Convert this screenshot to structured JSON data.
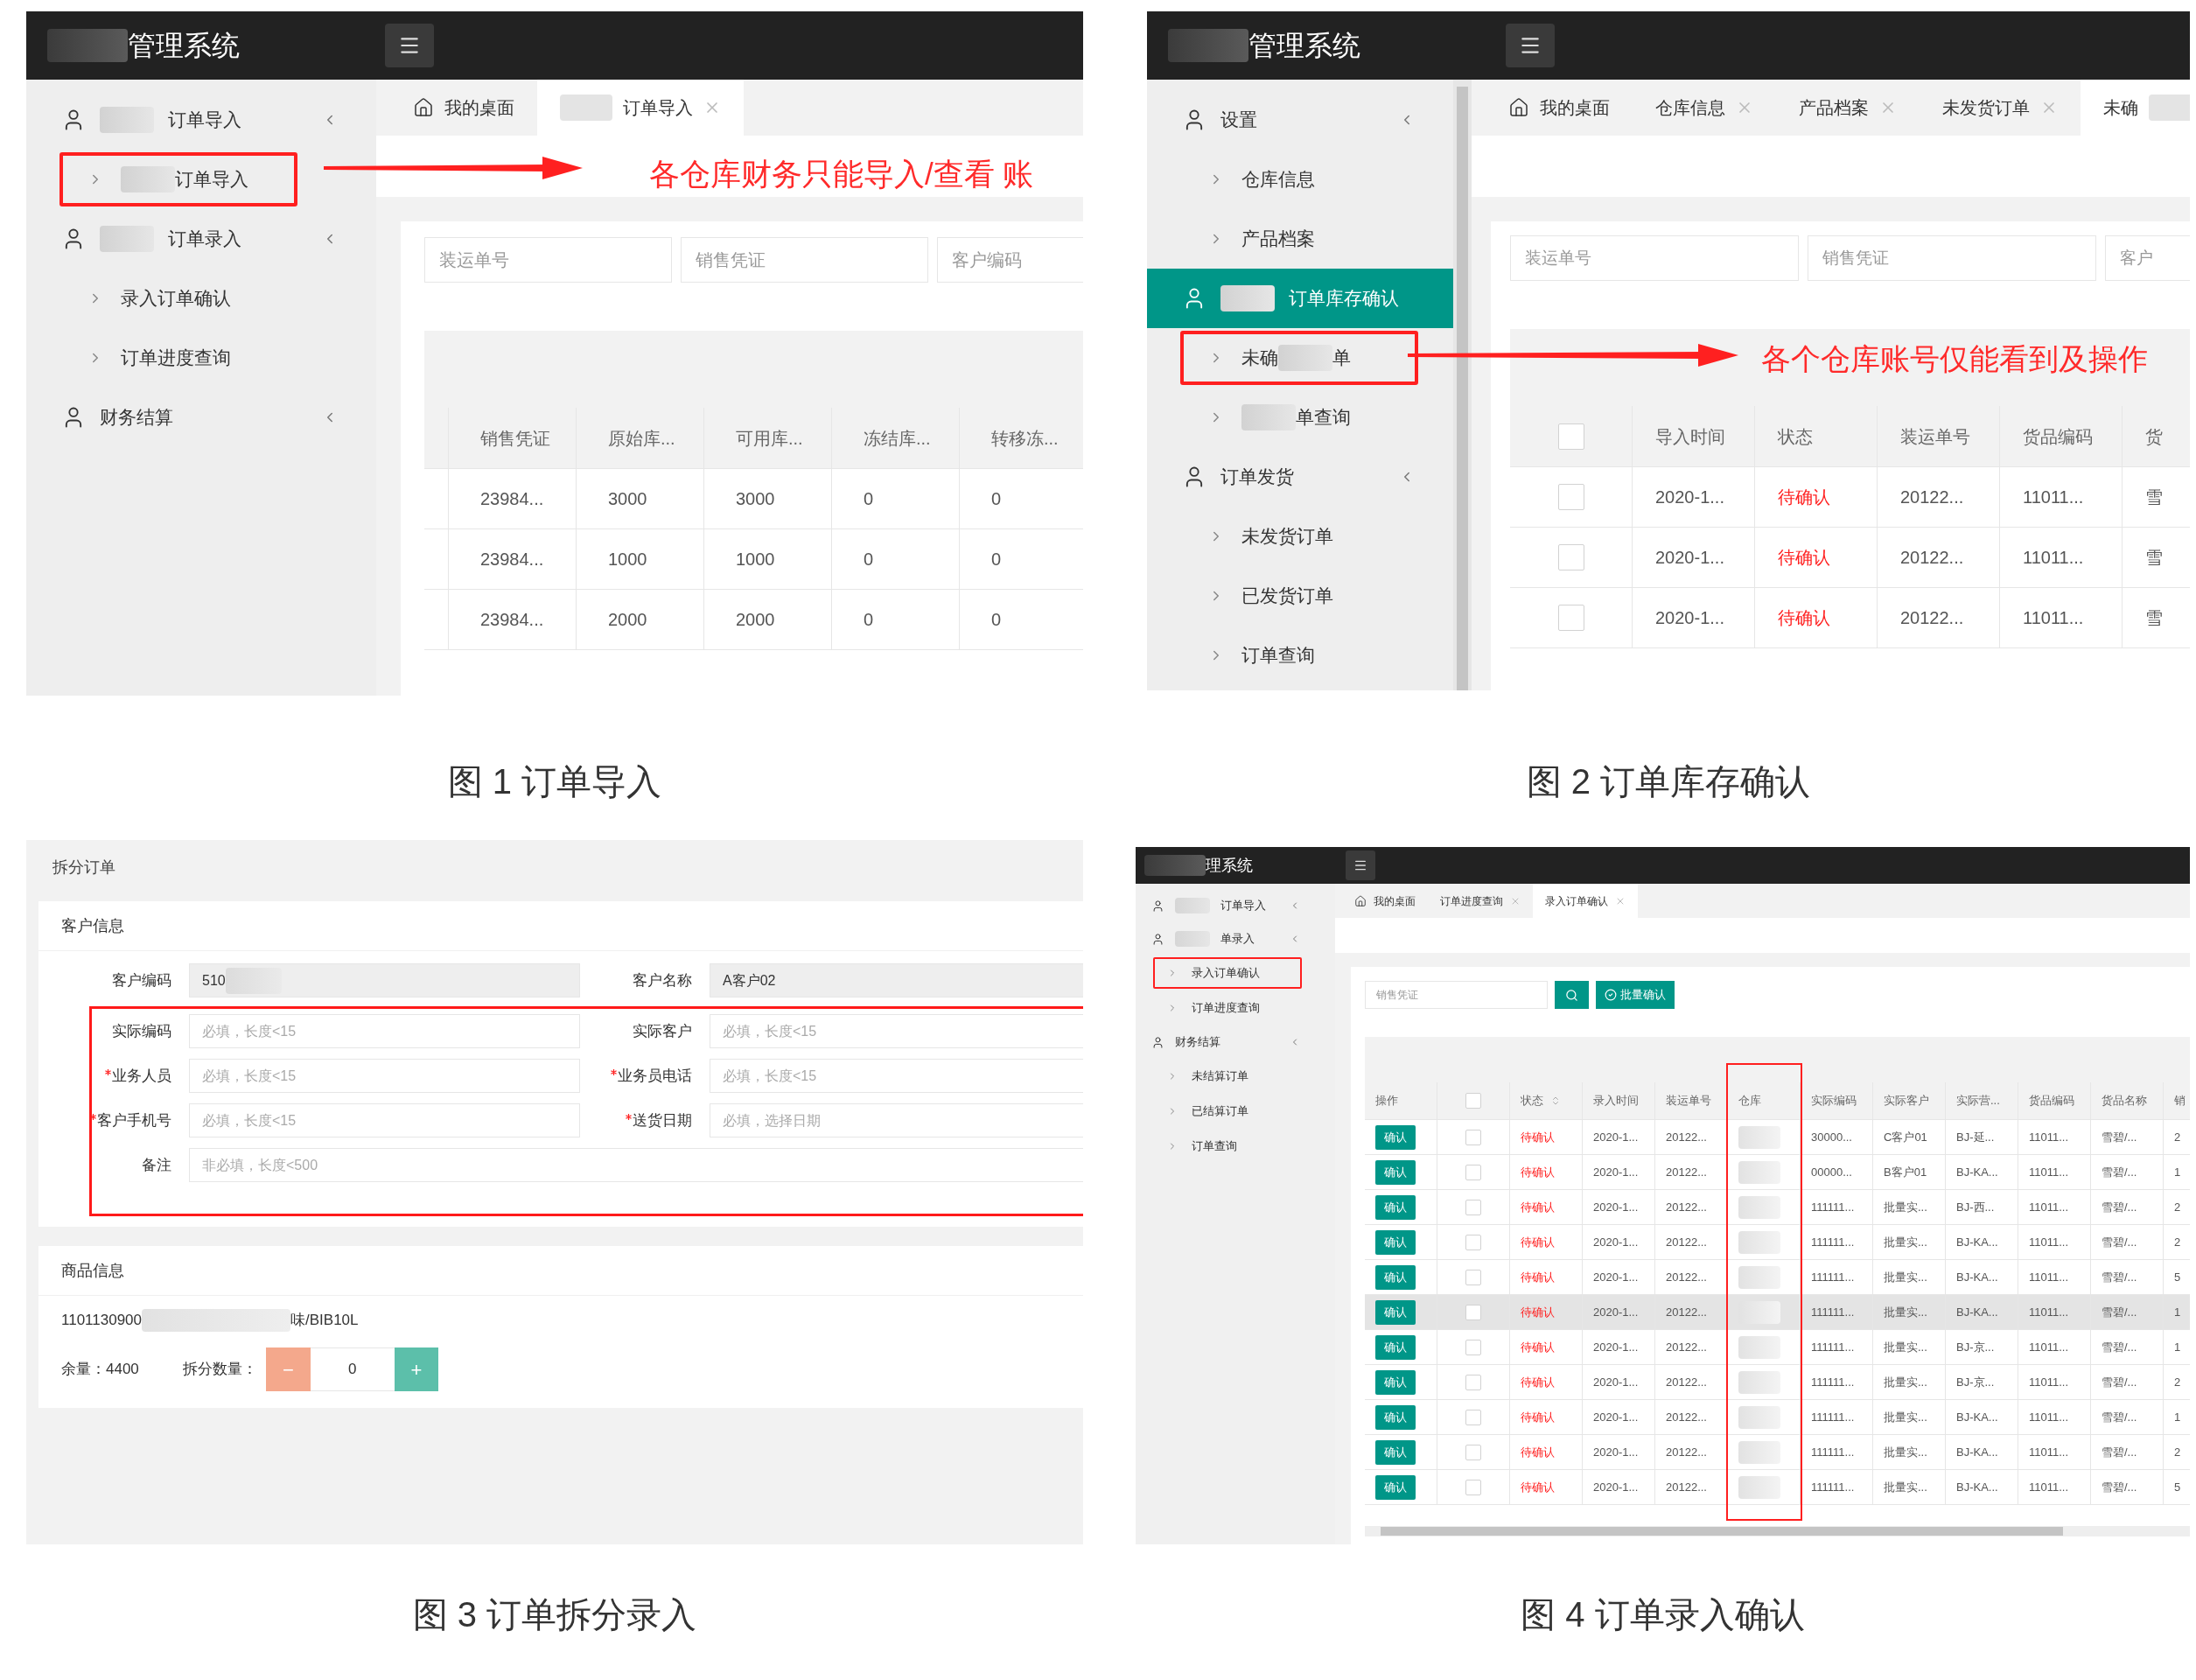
{
  "figure_1": {
    "logo": {
      "label": "管理系统",
      "mask_before": true
    },
    "sidebar": [
      {
        "label": "订单导入",
        "mask_before": true,
        "selected": false,
        "children": [
          {
            "label": "订单导入",
            "mask_before": true,
            "highlighted": true
          }
        ]
      },
      {
        "label": "订单录入",
        "mask_before": true,
        "selected": false,
        "children": [
          {
            "label": "录入订单确认",
            "highlighted": false
          },
          {
            "label": "订单进度查询",
            "highlighted": false
          }
        ]
      },
      {
        "label": "财务结算",
        "selected": false
      }
    ],
    "tabs": [
      {
        "kind": "home",
        "label": "我的桌面",
        "selected": false,
        "closable": false
      },
      {
        "kind": "page",
        "label": "订单导入",
        "mask_before": true,
        "selected": true,
        "closable": true
      }
    ],
    "annotation": "各仓库财务只能导入/查看 账",
    "filters": [
      {
        "placeholder": "装运单号"
      },
      {
        "placeholder": "销售凭证"
      },
      {
        "placeholder": "客户编码"
      }
    ],
    "table": {
      "columns": [
        {
          "kind": "text",
          "label": "销售凭证"
        },
        {
          "kind": "text",
          "label": "原始库..."
        },
        {
          "kind": "text",
          "label": "可用库..."
        },
        {
          "kind": "text",
          "label": "冻结库..."
        },
        {
          "kind": "text",
          "label": "转移冻..."
        }
      ],
      "rows": [
        {
          "cells": [
            "23984...",
            "3000",
            "3000",
            "0",
            "0"
          ]
        },
        {
          "cells": [
            "23984...",
            "1000",
            "1000",
            "0",
            "0"
          ]
        },
        {
          "cells": [
            "23984...",
            "2000",
            "2000",
            "0",
            "0"
          ]
        }
      ]
    },
    "caption": "图 1 订单导入"
  },
  "figure_2": {
    "logo": {
      "label": "管理系统",
      "mask_before": true
    },
    "sidebar": [
      {
        "label": "设置",
        "selected": false,
        "children": [
          {
            "label": "仓库信息",
            "highlighted": false
          },
          {
            "label": "产品档案",
            "highlighted": false
          }
        ]
      },
      {
        "label": "订单库存确认",
        "mask_before": true,
        "selected": true,
        "children": [
          {
            "label": "未确",
            "mask_after": true,
            "label_end": "单",
            "highlighted": true
          },
          {
            "label": "单查询",
            "mask_before": true,
            "highlighted": false
          }
        ]
      },
      {
        "label": "订单发货",
        "selected": false,
        "children": [
          {
            "label": "未发货订单",
            "highlighted": false
          },
          {
            "label": "已发货订单",
            "highlighted": false
          },
          {
            "label": "订单查询",
            "highlighted": false
          }
        ]
      }
    ],
    "tabs": [
      {
        "kind": "home",
        "label": "我的桌面",
        "selected": false,
        "closable": false
      },
      {
        "kind": "page",
        "label": "仓库信息",
        "selected": false,
        "closable": true
      },
      {
        "kind": "page",
        "label": "产品档案",
        "selected": false,
        "closable": true
      },
      {
        "kind": "page",
        "label": "未发货订单",
        "selected": false,
        "closable": true
      },
      {
        "kind": "page",
        "label": "未确",
        "mask_after": true,
        "selected": true,
        "closable": false
      }
    ],
    "annotation": "各个仓库账号仅能看到及操作",
    "filters": [
      {
        "placeholder": "装运单号"
      },
      {
        "placeholder": "销售凭证"
      },
      {
        "placeholder": "客户"
      }
    ],
    "table": {
      "header_checked": false,
      "columns": [
        {
          "kind": "checkbox"
        },
        {
          "kind": "text",
          "label": "导入时间"
        },
        {
          "kind": "text",
          "label": "状态"
        },
        {
          "kind": "text",
          "label": "装运单号"
        },
        {
          "kind": "text",
          "label": "货品编码"
        },
        {
          "kind": "text",
          "label": "货"
        }
      ],
      "rows": [
        {
          "cells": [
            {
              "kind": "checkbox",
              "checked": false
            },
            "2020-1...",
            {
              "kind": "status",
              "text": "待确认"
            },
            "20122...",
            "11011...",
            "雪"
          ]
        },
        {
          "cells": [
            {
              "kind": "checkbox",
              "checked": false
            },
            "2020-1...",
            {
              "kind": "status",
              "text": "待确认"
            },
            "20122...",
            "11011...",
            "雪"
          ]
        },
        {
          "cells": [
            {
              "kind": "checkbox",
              "checked": false
            },
            "2020-1...",
            {
              "kind": "status",
              "text": "待确认"
            },
            "20122...",
            "11011...",
            "雪"
          ]
        }
      ]
    },
    "caption": "图 2 订单库存确认"
  },
  "figure_3": {
    "title": "拆分订单",
    "customer_info": {
      "title": "客户信息",
      "rows": [
        [
          {
            "label": "客户编码",
            "required": false,
            "readonly": true,
            "value": "510",
            "mask_after": true
          },
          {
            "label": "客户名称",
            "required": false,
            "readonly": true,
            "value": "A客户02"
          }
        ]
      ],
      "highlighted_fields": {
        "highlighted": true,
        "rows": [
          [
            {
              "label": "实际编码",
              "required": false,
              "readonly": false,
              "placeholder": "必填，长度<15"
            },
            {
              "label": "实际客户",
              "required": false,
              "readonly": false,
              "placeholder": "必填，长度<15"
            }
          ],
          [
            {
              "label": "业务人员",
              "required": true,
              "readonly": false,
              "placeholder": "必填，长度<15"
            },
            {
              "label": "业务员电话",
              "required": true,
              "readonly": false,
              "placeholder": "必填，长度<15"
            }
          ],
          [
            {
              "label": "客户手机号",
              "required": true,
              "readonly": false,
              "placeholder": "必填，长度<15"
            },
            {
              "label": "送货日期",
              "required": true,
              "readonly": false,
              "placeholder": "必填，选择日期"
            }
          ],
          [
            {
              "label": "备注",
              "required": false,
              "readonly": false,
              "placeholder": "非必填，长度<500"
            }
          ]
        ]
      }
    },
    "product_info": {
      "title": "商品信息",
      "product": {
        "label": "1101130900",
        "mask_after": true,
        "label_end": "味/BIB10L"
      },
      "stock": "余量：4400",
      "split_label": "拆分数量：",
      "decrement": "−",
      "quantity": "0",
      "increment": "+"
    },
    "caption": "图 3 订单拆分录入"
  },
  "figure_4": {
    "logo": {
      "label": "理系统",
      "mask_before": true
    },
    "sidebar": [
      {
        "label": "订单导入",
        "mask_before": true,
        "selected": false
      },
      {
        "label": "单录入",
        "mask_before": true,
        "selected": false,
        "children": [
          {
            "label": "录入订单确认",
            "highlighted": true
          },
          {
            "label": "订单进度查询",
            "highlighted": false
          }
        ]
      },
      {
        "label": "财务结算",
        "selected": false,
        "children": [
          {
            "label": "未结算订单",
            "highlighted": false
          },
          {
            "label": "已结算订单",
            "highlighted": false
          },
          {
            "label": "订单查询",
            "highlighted": false
          }
        ]
      }
    ],
    "tabs": [
      {
        "kind": "home",
        "label": "我的桌面",
        "selected": false,
        "closable": false
      },
      {
        "kind": "page",
        "label": "订单进度查询",
        "selected": false,
        "closable": true
      },
      {
        "kind": "page",
        "label": "录入订单确认",
        "selected": true,
        "closable": true
      }
    ],
    "search": {
      "placeholder": "销售凭证"
    },
    "batch_confirm": "批量确认",
    "table": {
      "header_checked": false,
      "columns": [
        {
          "kind": "text",
          "label": "操作"
        },
        {
          "kind": "checkbox"
        },
        {
          "kind": "text",
          "label": "状态",
          "sortable": true
        },
        {
          "kind": "text",
          "label": "录入时间"
        },
        {
          "kind": "text",
          "label": "装运单号"
        },
        {
          "kind": "text",
          "label": "仓库",
          "highlighted": true
        },
        {
          "kind": "text",
          "label": "实际编码"
        },
        {
          "kind": "text",
          "label": "实际客户"
        },
        {
          "kind": "text",
          "label": "实际营..."
        },
        {
          "kind": "text",
          "label": "货品编码"
        },
        {
          "kind": "text",
          "label": "货品名称"
        },
        {
          "kind": "text",
          "label": "销"
        }
      ],
      "rows": [
        {
          "hovered": false,
          "cells": [
            {
              "kind": "action",
              "text": "确认"
            },
            {
              "kind": "checkbox",
              "checked": false
            },
            {
              "kind": "status",
              "text": "待确认"
            },
            "2020-1...",
            "20122...",
            {
              "kind": "masked"
            },
            "30000...",
            "C客户01",
            "BJ-延...",
            "11011...",
            "雪碧/...",
            "2"
          ]
        },
        {
          "hovered": false,
          "cells": [
            {
              "kind": "action",
              "text": "确认"
            },
            {
              "kind": "checkbox",
              "checked": false
            },
            {
              "kind": "status",
              "text": "待确认"
            },
            "2020-1...",
            "20122...",
            {
              "kind": "masked"
            },
            "00000...",
            "B客户01",
            "BJ-KA...",
            "11011...",
            "雪碧/...",
            "1"
          ]
        },
        {
          "hovered": false,
          "cells": [
            {
              "kind": "action",
              "text": "确认"
            },
            {
              "kind": "checkbox",
              "checked": false
            },
            {
              "kind": "status",
              "text": "待确认"
            },
            "2020-1...",
            "20122...",
            {
              "kind": "masked"
            },
            "111111...",
            "批量实...",
            "BJ-西...",
            "11011...",
            "雪碧/...",
            "2"
          ]
        },
        {
          "hovered": false,
          "cells": [
            {
              "kind": "action",
              "text": "确认"
            },
            {
              "kind": "checkbox",
              "checked": false
            },
            {
              "kind": "status",
              "text": "待确认"
            },
            "2020-1...",
            "20122...",
            {
              "kind": "masked"
            },
            "111111...",
            "批量实...",
            "BJ-KA...",
            "11011...",
            "雪碧/...",
            "2"
          ]
        },
        {
          "hovered": false,
          "cells": [
            {
              "kind": "action",
              "text": "确认"
            },
            {
              "kind": "checkbox",
              "checked": false
            },
            {
              "kind": "status",
              "text": "待确认"
            },
            "2020-1...",
            "20122...",
            {
              "kind": "masked"
            },
            "111111...",
            "批量实...",
            "BJ-KA...",
            "11011...",
            "雪碧/...",
            "5"
          ]
        },
        {
          "hovered": true,
          "cells": [
            {
              "kind": "action",
              "text": "确认"
            },
            {
              "kind": "checkbox",
              "checked": false
            },
            {
              "kind": "status",
              "text": "待确认"
            },
            "2020-1...",
            "20122...",
            {
              "kind": "masked"
            },
            "111111...",
            "批量实...",
            "BJ-KA...",
            "11011...",
            "雪碧/...",
            "1"
          ]
        },
        {
          "hovered": false,
          "cells": [
            {
              "kind": "action",
              "text": "确认"
            },
            {
              "kind": "checkbox",
              "checked": false
            },
            {
              "kind": "status",
              "text": "待确认"
            },
            "2020-1...",
            "20122...",
            {
              "kind": "masked"
            },
            "111111...",
            "批量实...",
            "BJ-京...",
            "11011...",
            "雪碧/...",
            "1"
          ]
        },
        {
          "hovered": false,
          "cells": [
            {
              "kind": "action",
              "text": "确认"
            },
            {
              "kind": "checkbox",
              "checked": false
            },
            {
              "kind": "status",
              "text": "待确认"
            },
            "2020-1...",
            "20122...",
            {
              "kind": "masked"
            },
            "111111...",
            "批量实...",
            "BJ-京...",
            "11011...",
            "雪碧/...",
            "2"
          ]
        },
        {
          "hovered": false,
          "cells": [
            {
              "kind": "action",
              "text": "确认"
            },
            {
              "kind": "checkbox",
              "checked": false
            },
            {
              "kind": "status",
              "text": "待确认"
            },
            "2020-1...",
            "20122...",
            {
              "kind": "masked"
            },
            "111111...",
            "批量实...",
            "BJ-KA...",
            "11011...",
            "雪碧/...",
            "1"
          ]
        },
        {
          "hovered": false,
          "cells": [
            {
              "kind": "action",
              "text": "确认"
            },
            {
              "kind": "checkbox",
              "checked": false
            },
            {
              "kind": "status",
              "text": "待确认"
            },
            "2020-1...",
            "20122...",
            {
              "kind": "masked"
            },
            "111111...",
            "批量实...",
            "BJ-KA...",
            "11011...",
            "雪碧/...",
            "2"
          ]
        },
        {
          "hovered": false,
          "cells": [
            {
              "kind": "action",
              "text": "确认"
            },
            {
              "kind": "checkbox",
              "checked": false
            },
            {
              "kind": "status",
              "text": "待确认"
            },
            "2020-1...",
            "20122...",
            {
              "kind": "masked"
            },
            "111111...",
            "批量实...",
            "BJ-KA...",
            "11011...",
            "雪碧/...",
            "5"
          ]
        }
      ]
    },
    "caption": "图 4 订单录入确认"
  }
}
